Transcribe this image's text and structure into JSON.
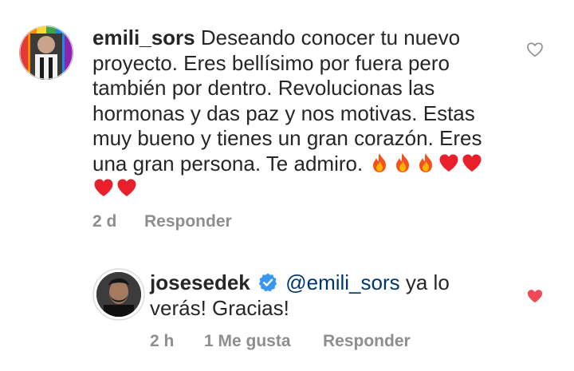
{
  "comment": {
    "username": "emili_sors",
    "text": "Deseando conocer tu nuevo proyecto. Eres bellísimo por fuera pero también por dentro. Revolucionas las hormonas y das paz y nos motivas. Estas muy bueno y tienes un gran corazón. Eres una gran persona.  Te admiro.",
    "emojis": [
      "fire",
      "fire",
      "fire",
      "red-heart",
      "red-heart",
      "red-heart",
      "red-heart"
    ],
    "time": "2 d",
    "reply_label": "Responder",
    "liked": false
  },
  "reply": {
    "username": "josesedek",
    "verified": true,
    "mention": "@emili_sors",
    "text": "ya lo verás! Gracias!",
    "time": "2 h",
    "likes": "1 Me gusta",
    "reply_label": "Responder",
    "liked": true
  },
  "colors": {
    "text": "#262626",
    "meta": "#8e8e8e",
    "mention": "#00376b",
    "like_active": "#ed4956",
    "like_inactive": "#8e8e8e",
    "verified": "#3897f0"
  },
  "icons": {
    "like_empty": "heart-outline-icon",
    "like_filled": "heart-filled-icon",
    "verified": "verified-badge-icon"
  }
}
